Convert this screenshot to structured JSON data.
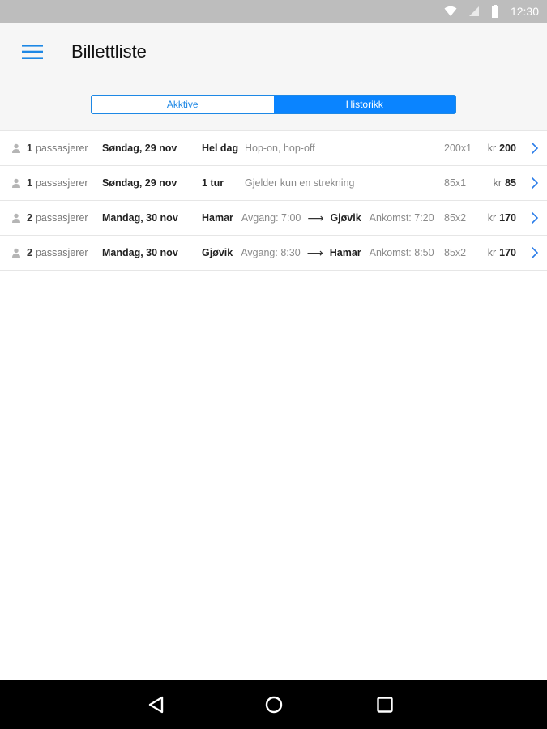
{
  "status_bar": {
    "time": "12:30",
    "icons": [
      "wifi-icon",
      "signal-icon",
      "battery-icon"
    ]
  },
  "header": {
    "title": "Billettliste",
    "menu_icon": "hamburger-menu-icon"
  },
  "tabs": [
    {
      "label": "Akktive",
      "active": false
    },
    {
      "label": "Historikk",
      "active": true
    }
  ],
  "tickets": [
    {
      "pax_count": "1",
      "pax_label": "passasjerer",
      "date": "Søndag, 29 nov",
      "type": "Hel dag",
      "description": "Hop-on, hop-off",
      "code": "200x1",
      "currency": "kr",
      "price": "200"
    },
    {
      "pax_count": "1",
      "pax_label": "passasjerer",
      "date": "Søndag, 29 nov",
      "type": "1 tur",
      "description": "Gjelder kun en strekning",
      "code": "85x1",
      "currency": "kr",
      "price": "85"
    },
    {
      "pax_count": "2",
      "pax_label": "passasjerer",
      "date": "Mandag, 30 nov",
      "from": "Hamar",
      "departure": "Avgang: 7:00",
      "to": "Gjøvik",
      "arrival": "Ankomst: 7:20",
      "code": "85x2",
      "currency": "kr",
      "price": "170"
    },
    {
      "pax_count": "2",
      "pax_label": "passasjerer",
      "date": "Mandag, 30 nov",
      "from": "Gjøvik",
      "departure": "Avgang: 8:30",
      "to": "Hamar",
      "arrival": "Ankomst: 8:50",
      "code": "85x2",
      "currency": "kr",
      "price": "170"
    }
  ],
  "colors": {
    "accent": "#0a84ff",
    "appbar_bg": "#f6f6f6",
    "status_bar_bg": "#bdbdbd",
    "nav_bar_bg": "#000000"
  },
  "nav_bar": {
    "icons": [
      "back-icon",
      "home-icon",
      "recent-apps-icon"
    ]
  }
}
